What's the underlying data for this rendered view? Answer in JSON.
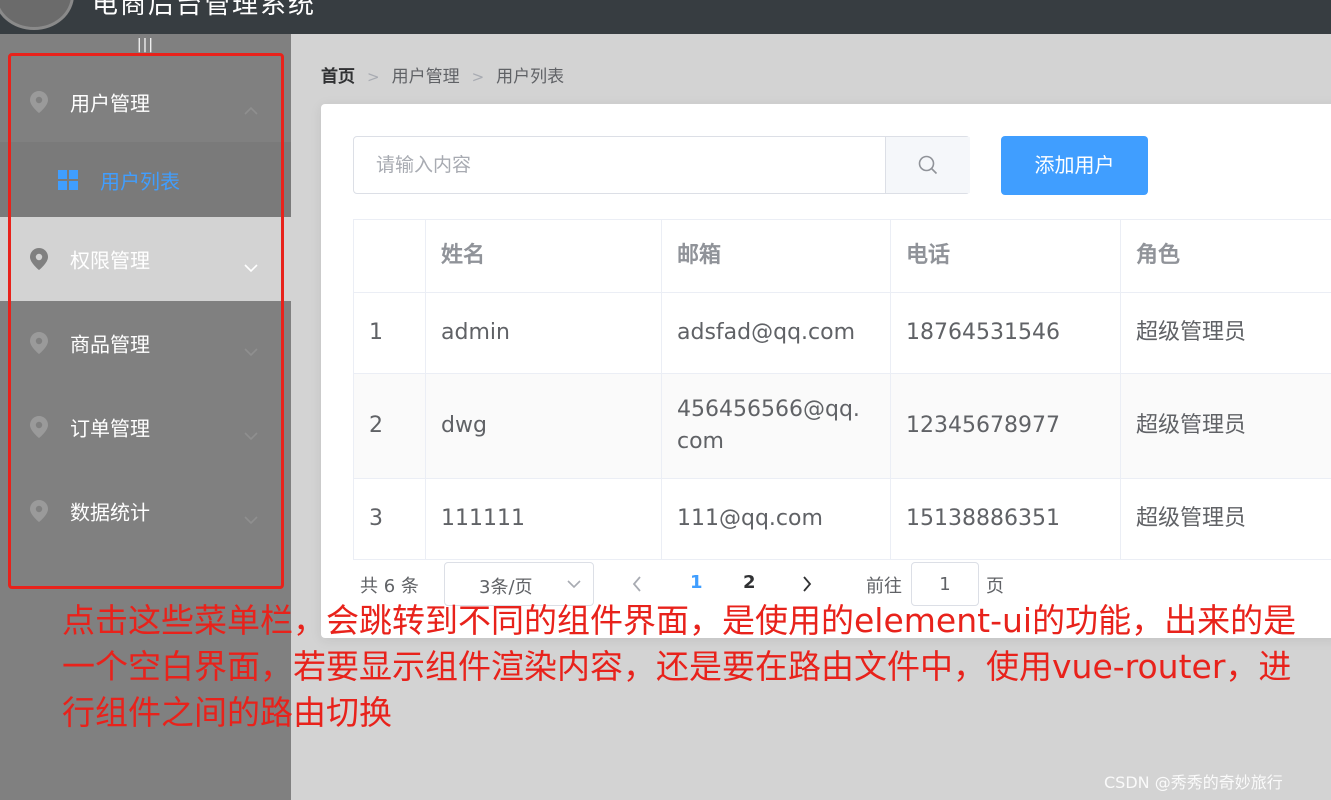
{
  "header": {
    "title": "电商后台管理系统"
  },
  "sidebar": {
    "toggle_label": "|||",
    "items": [
      {
        "label": "用户管理",
        "expanded": true
      },
      {
        "label": "权限管理"
      },
      {
        "label": "商品管理"
      },
      {
        "label": "订单管理"
      },
      {
        "label": "数据统计"
      }
    ],
    "submenu": [
      {
        "label": "用户列表",
        "active": true
      }
    ]
  },
  "breadcrumb": {
    "home": "首页",
    "level1": "用户管理",
    "level2": "用户列表"
  },
  "search": {
    "placeholder": "请输入内容",
    "value": ""
  },
  "toolbar": {
    "add_label": "添加用户"
  },
  "table": {
    "columns": [
      "",
      "姓名",
      "邮箱",
      "电话",
      "角色"
    ],
    "rows": [
      {
        "index": "1",
        "name": "admin",
        "email": "adsfad@qq.com",
        "phone": "18764531546",
        "role": "超级管理员"
      },
      {
        "index": "2",
        "name": "dwg",
        "email": "456456566@qq.com",
        "phone": "12345678977",
        "role": "超级管理员"
      },
      {
        "index": "3",
        "name": "111111",
        "email": "111@qq.com",
        "phone": "15138886351",
        "role": "超级管理员"
      }
    ]
  },
  "pagination": {
    "total_text": "共 6 条",
    "page_size": "3条/页",
    "pages": [
      "1",
      "2"
    ],
    "current_page": "1",
    "goto_prefix": "前往",
    "goto_value": "1",
    "goto_suffix": "页"
  },
  "annotation": {
    "text": "点击这些菜单栏，会跳转到不同的组件界面，是使用的element-ui的功能，出来的是一个空白界面，若要显示组件渲染内容，还是要在路由文件中，使用vue-router，进行组件之间的路由切换"
  },
  "watermark": {
    "text": "CSDN @秀秀的奇妙旅行"
  },
  "colors": {
    "accent": "#409eff",
    "header_bg": "#373d41",
    "sidebar_bg": "#808080",
    "annotation_red": "#e8221b"
  }
}
